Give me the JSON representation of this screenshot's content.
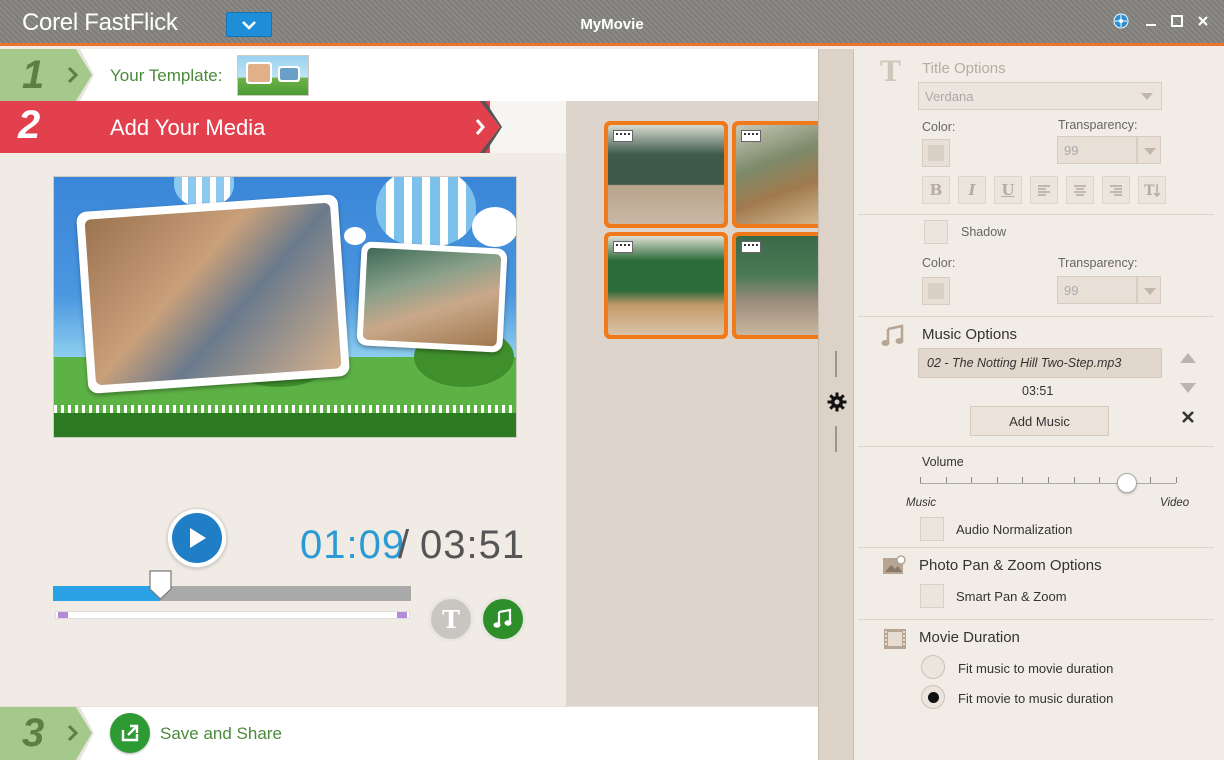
{
  "app": {
    "name": "Corel FastFlick",
    "project_title": "MyMovie"
  },
  "steps": {
    "step1": {
      "number": "1",
      "label": "Your Template:"
    },
    "step2": {
      "number": "2",
      "label": "Add Your Media"
    },
    "step3": {
      "number": "3",
      "label": "Save and Share"
    }
  },
  "player": {
    "current_time": "01:09",
    "separator": "/",
    "total_time": "03:51",
    "progress": 0.3
  },
  "title_options": {
    "header": "Title Options",
    "font": "Verdana",
    "color_label": "Color:",
    "transparency_label": "Transparency:",
    "transparency_value": "99",
    "format_buttons": [
      "B",
      "I",
      "U"
    ],
    "shadow_label": "Shadow",
    "shadow_color_label": "Color:",
    "shadow_transparency_label": "Transparency:",
    "shadow_transparency_value": "99"
  },
  "music_options": {
    "header": "Music Options",
    "track": "02 - The Notting Hill Two-Step.mp3",
    "track_duration": "03:51",
    "add_music_label": "Add Music",
    "volume_label": "Volume",
    "volume_left": "Music",
    "volume_right": "Video",
    "volume_level": 0.81,
    "audio_normalization_label": "Audio Normalization"
  },
  "pan_zoom": {
    "header": "Photo Pan & Zoom Options",
    "smart_label": "Smart Pan & Zoom"
  },
  "movie_duration": {
    "header": "Movie Duration",
    "options": [
      "Fit music to movie duration",
      "Fit movie to music duration"
    ],
    "selected_index": 1
  },
  "colors": {
    "accent_orange": "#e9742a",
    "step2_red": "#e2404d",
    "time_blue": "#2a9ad4",
    "play_blue": "#1f7ec6"
  }
}
